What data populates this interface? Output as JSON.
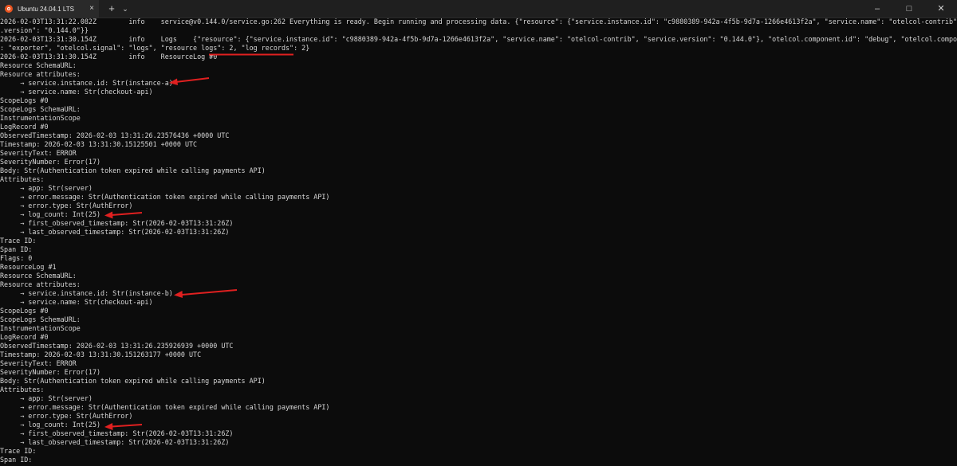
{
  "window": {
    "tab_title": "Ubuntu 24.04.1 LTS",
    "tab_close": "×",
    "new_tab": "+",
    "dropdown": "⌄",
    "minimize": "–",
    "maximize": "□",
    "close": "✕"
  },
  "annotation_color": "#e02020",
  "lines": [
    "2026-02-03T13:31:22.082Z        info    service@v0.144.0/service.go:262 Everything is ready. Begin running and processing data. {\"resource\": {\"service.instance.id\": \"c9880389-942a-4f5b-9d7a-1266e4613f2a\", \"service.name\": \"otelcol-contrib\", \"service",
    ".version\": \"0.144.0\"}}",
    "2026-02-03T13:31:30.154Z        info    Logs    {\"resource\": {\"service.instance.id\": \"c9880389-942a-4f5b-9d7a-1266e4613f2a\", \"service.name\": \"otelcol-contrib\", \"service.version\": \"0.144.0\"}, \"otelcol.component.id\": \"debug\", \"otelcol.component.kind",
    ": \"exporter\", \"otelcol.signal\": \"logs\", \"resource logs\": 2, \"log records\": 2}",
    "2026-02-03T13:31:30.154Z        info    ResourceLog #0",
    "Resource SchemaURL:",
    "Resource attributes:",
    "     → service.instance.id: Str(instance-a)",
    "     → service.name: Str(checkout-api)",
    "ScopeLogs #0",
    "ScopeLogs SchemaURL:",
    "InstrumentationScope",
    "LogRecord #0",
    "ObservedTimestamp: 2026-02-03 13:31:26.23576436 +0000 UTC",
    "Timestamp: 2026-02-03 13:31:30.15125501 +0000 UTC",
    "SeverityText: ERROR",
    "SeverityNumber: Error(17)",
    "Body: Str(Authentication token expired while calling payments API)",
    "Attributes:",
    "     → app: Str(server)",
    "     → error.message: Str(Authentication token expired while calling payments API)",
    "     → error.type: Str(AuthError)",
    "     → log_count: Int(25)",
    "     → first_observed_timestamp: Str(2026-02-03T13:31:26Z)",
    "     → last_observed_timestamp: Str(2026-02-03T13:31:26Z)",
    "Trace ID:",
    "Span ID:",
    "Flags: 0",
    "ResourceLog #1",
    "Resource SchemaURL:",
    "Resource attributes:",
    "     → service.instance.id: Str(instance-b)",
    "     → service.name: Str(checkout-api)",
    "ScopeLogs #0",
    "ScopeLogs SchemaURL:",
    "InstrumentationScope",
    "LogRecord #0",
    "ObservedTimestamp: 2026-02-03 13:31:26.235926939 +0000 UTC",
    "Timestamp: 2026-02-03 13:31:30.151263177 +0000 UTC",
    "SeverityText: ERROR",
    "SeverityNumber: Error(17)",
    "Body: Str(Authentication token expired while calling payments API)",
    "Attributes:",
    "     → app: Str(server)",
    "     → error.message: Str(Authentication token expired while calling payments API)",
    "     → error.type: Str(AuthError)",
    "     → log_count: Int(25)",
    "     → first_observed_timestamp: Str(2026-02-03T13:31:26Z)",
    "     → last_observed_timestamp: Str(2026-02-03T13:31:26Z)",
    "Trace ID:",
    "Span ID:"
  ]
}
